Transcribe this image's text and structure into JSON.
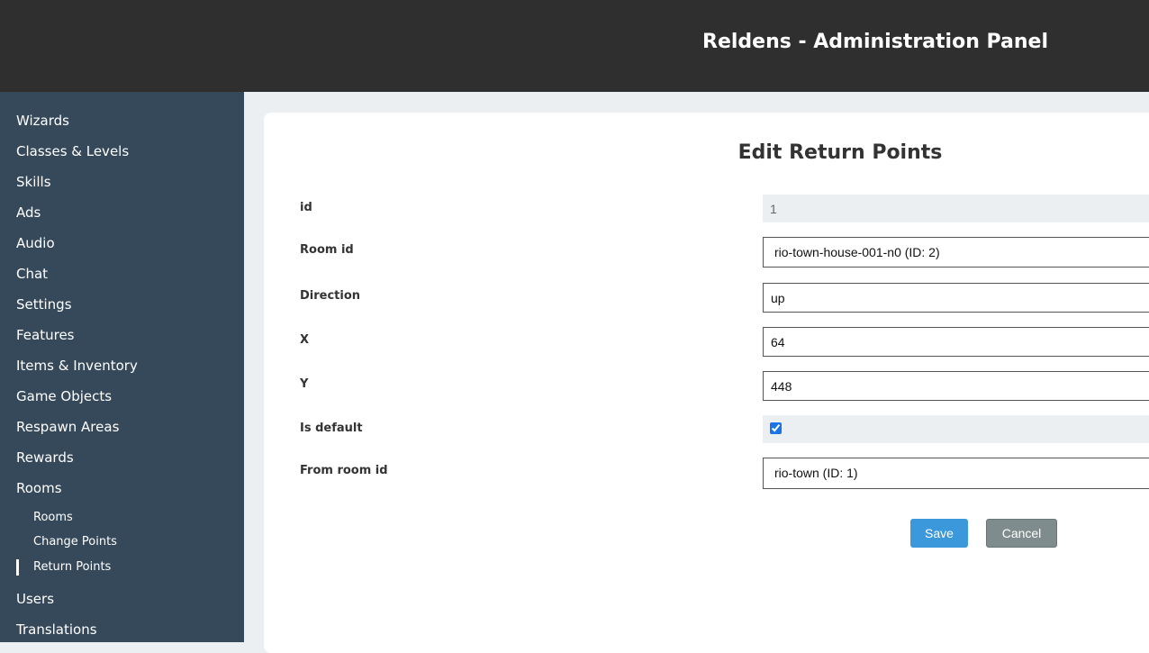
{
  "app": {
    "title": "Reldens - Administration Panel"
  },
  "sidebar": {
    "items": [
      {
        "label": "Wizards"
      },
      {
        "label": "Classes & Levels"
      },
      {
        "label": "Skills"
      },
      {
        "label": "Ads"
      },
      {
        "label": "Audio"
      },
      {
        "label": "Chat"
      },
      {
        "label": "Settings"
      },
      {
        "label": "Features"
      },
      {
        "label": "Items & Inventory"
      },
      {
        "label": "Game Objects"
      },
      {
        "label": "Respawn Areas"
      },
      {
        "label": "Rewards"
      },
      {
        "label": "Rooms"
      },
      {
        "label": "Users"
      },
      {
        "label": "Translations"
      }
    ],
    "rooms_subitems": [
      {
        "label": "Rooms"
      },
      {
        "label": "Change Points"
      },
      {
        "label": "Return Points",
        "active": true
      }
    ]
  },
  "form": {
    "title": "Edit Return Points",
    "fields": {
      "id": {
        "label": "id",
        "value": "1"
      },
      "room_id": {
        "label": "Room id",
        "value": "rio-town-house-001-n0 (ID: 2)"
      },
      "direction": {
        "label": "Direction",
        "value": "up"
      },
      "x": {
        "label": "X",
        "value": "64"
      },
      "y": {
        "label": "Y",
        "value": "448"
      },
      "is_default": {
        "label": "Is default",
        "checked": true
      },
      "from_room_id": {
        "label": "From room id",
        "value": "rio-town (ID: 1)"
      }
    },
    "save_label": "Save",
    "cancel_label": "Cancel"
  }
}
